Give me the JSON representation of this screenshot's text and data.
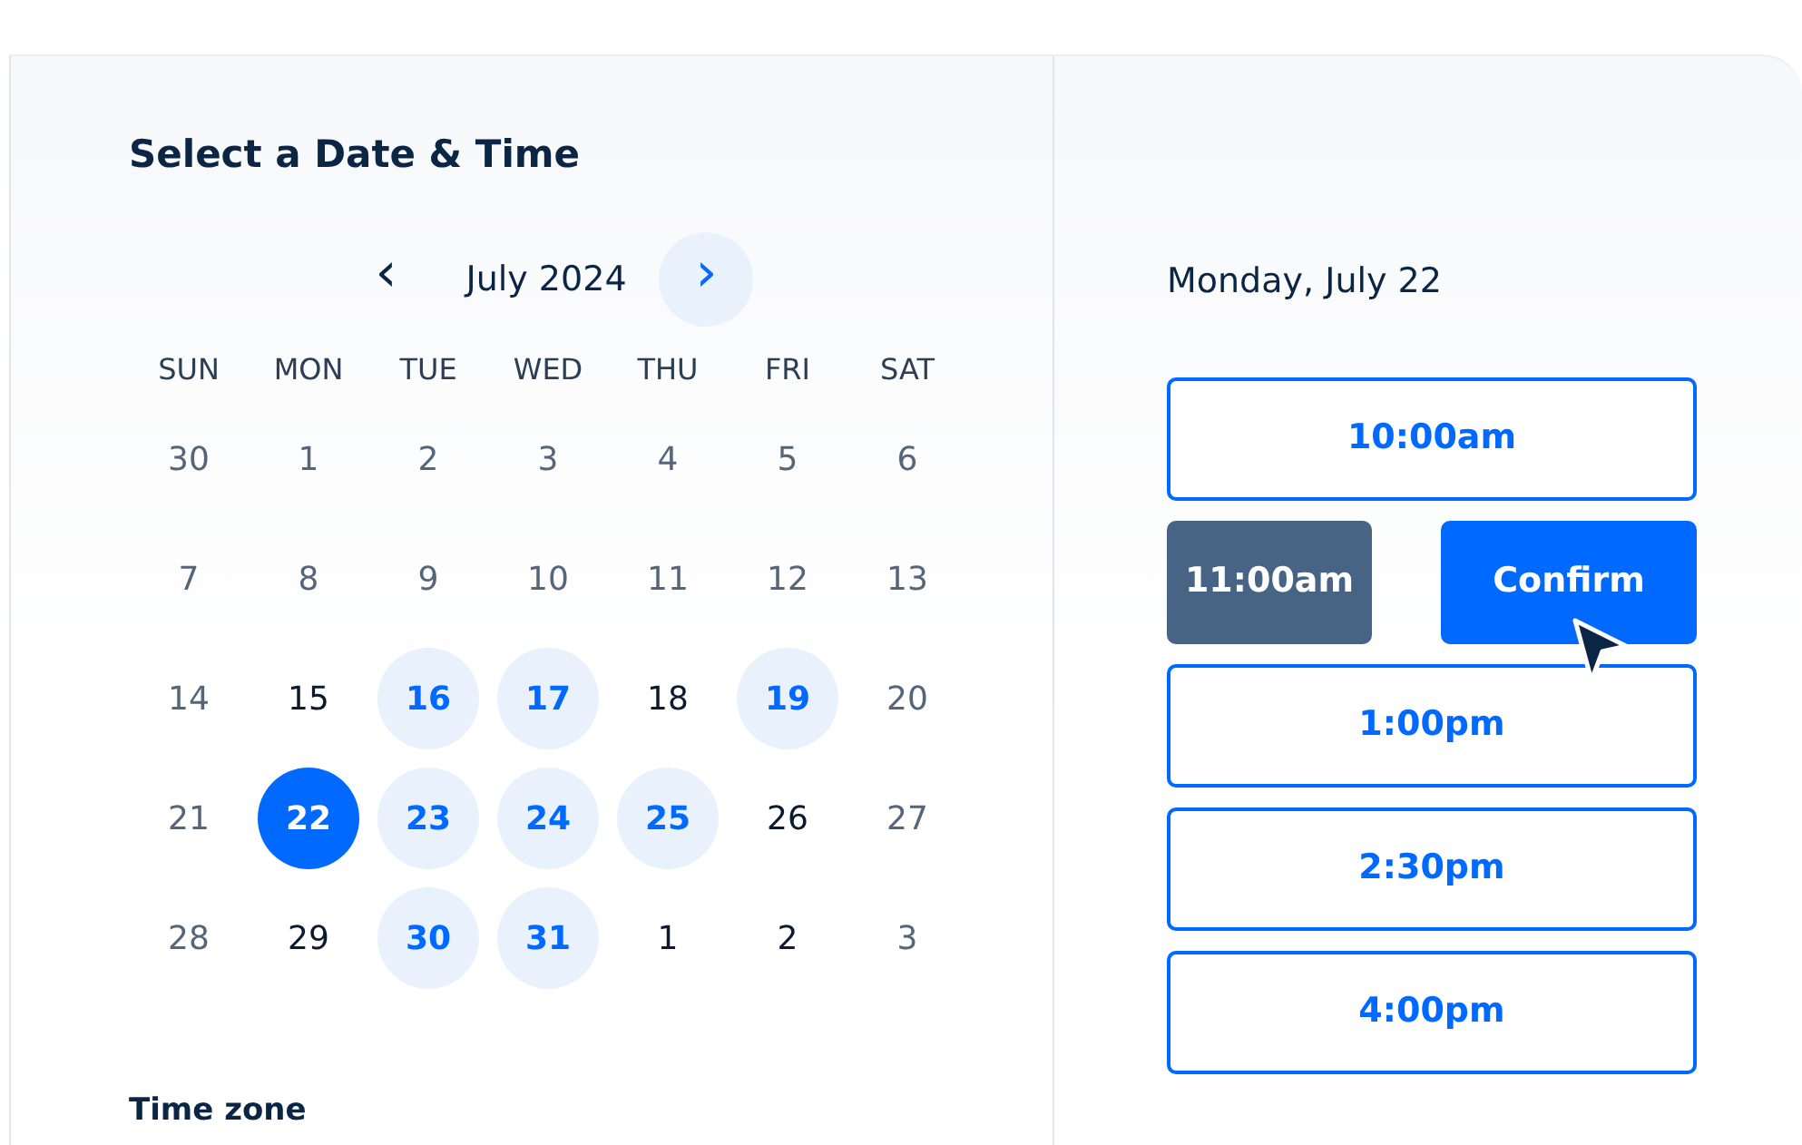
{
  "title": "Select a Date & Time",
  "month_nav": {
    "prev": "‹",
    "label": "July 2024",
    "next": "›"
  },
  "weekdays": [
    "SUN",
    "MON",
    "TUE",
    "WED",
    "THU",
    "FRI",
    "SAT"
  ],
  "days": [
    {
      "day": "30",
      "muted": true,
      "available": false,
      "selected": false
    },
    {
      "day": "1",
      "muted": true,
      "available": false,
      "selected": false
    },
    {
      "day": "2",
      "muted": true,
      "available": false,
      "selected": false
    },
    {
      "day": "3",
      "muted": true,
      "available": false,
      "selected": false
    },
    {
      "day": "4",
      "muted": true,
      "available": false,
      "selected": false
    },
    {
      "day": "5",
      "muted": true,
      "available": false,
      "selected": false
    },
    {
      "day": "6",
      "muted": true,
      "available": false,
      "selected": false
    },
    {
      "day": "7",
      "muted": true,
      "available": false,
      "selected": false
    },
    {
      "day": "8",
      "muted": true,
      "available": false,
      "selected": false
    },
    {
      "day": "9",
      "muted": true,
      "available": false,
      "selected": false
    },
    {
      "day": "10",
      "muted": true,
      "available": false,
      "selected": false
    },
    {
      "day": "11",
      "muted": true,
      "available": false,
      "selected": false
    },
    {
      "day": "12",
      "muted": true,
      "available": false,
      "selected": false
    },
    {
      "day": "13",
      "muted": true,
      "available": false,
      "selected": false
    },
    {
      "day": "14",
      "muted": true,
      "available": false,
      "selected": false
    },
    {
      "day": "15",
      "muted": false,
      "available": false,
      "selected": false
    },
    {
      "day": "16",
      "muted": false,
      "available": true,
      "selected": false
    },
    {
      "day": "17",
      "muted": false,
      "available": true,
      "selected": false
    },
    {
      "day": "18",
      "muted": false,
      "available": false,
      "selected": false
    },
    {
      "day": "19",
      "muted": false,
      "available": true,
      "selected": false
    },
    {
      "day": "20",
      "muted": true,
      "available": false,
      "selected": false
    },
    {
      "day": "21",
      "muted": true,
      "available": false,
      "selected": false
    },
    {
      "day": "22",
      "muted": false,
      "available": true,
      "selected": true
    },
    {
      "day": "23",
      "muted": false,
      "available": true,
      "selected": false
    },
    {
      "day": "24",
      "muted": false,
      "available": true,
      "selected": false
    },
    {
      "day": "25",
      "muted": false,
      "available": true,
      "selected": false
    },
    {
      "day": "26",
      "muted": false,
      "available": false,
      "selected": false
    },
    {
      "day": "27",
      "muted": true,
      "available": false,
      "selected": false
    },
    {
      "day": "28",
      "muted": true,
      "available": false,
      "selected": false
    },
    {
      "day": "29",
      "muted": false,
      "available": false,
      "selected": false
    },
    {
      "day": "30",
      "muted": false,
      "available": true,
      "selected": false
    },
    {
      "day": "31",
      "muted": false,
      "available": true,
      "selected": false
    },
    {
      "day": "1",
      "muted": false,
      "available": false,
      "selected": false
    },
    {
      "day": "2",
      "muted": false,
      "available": false,
      "selected": false
    },
    {
      "day": "3",
      "muted": true,
      "available": false,
      "selected": false
    }
  ],
  "time_zone_label": "Time zone",
  "selected_date": "Monday, July 22",
  "slots": [
    {
      "time": "10:00am",
      "selected": false
    },
    {
      "time": "11:00am",
      "selected": true
    },
    {
      "time": "1:00pm",
      "selected": false
    },
    {
      "time": "2:30pm",
      "selected": false
    },
    {
      "time": "4:00pm",
      "selected": false
    }
  ],
  "confirm_button": "Confirm"
}
